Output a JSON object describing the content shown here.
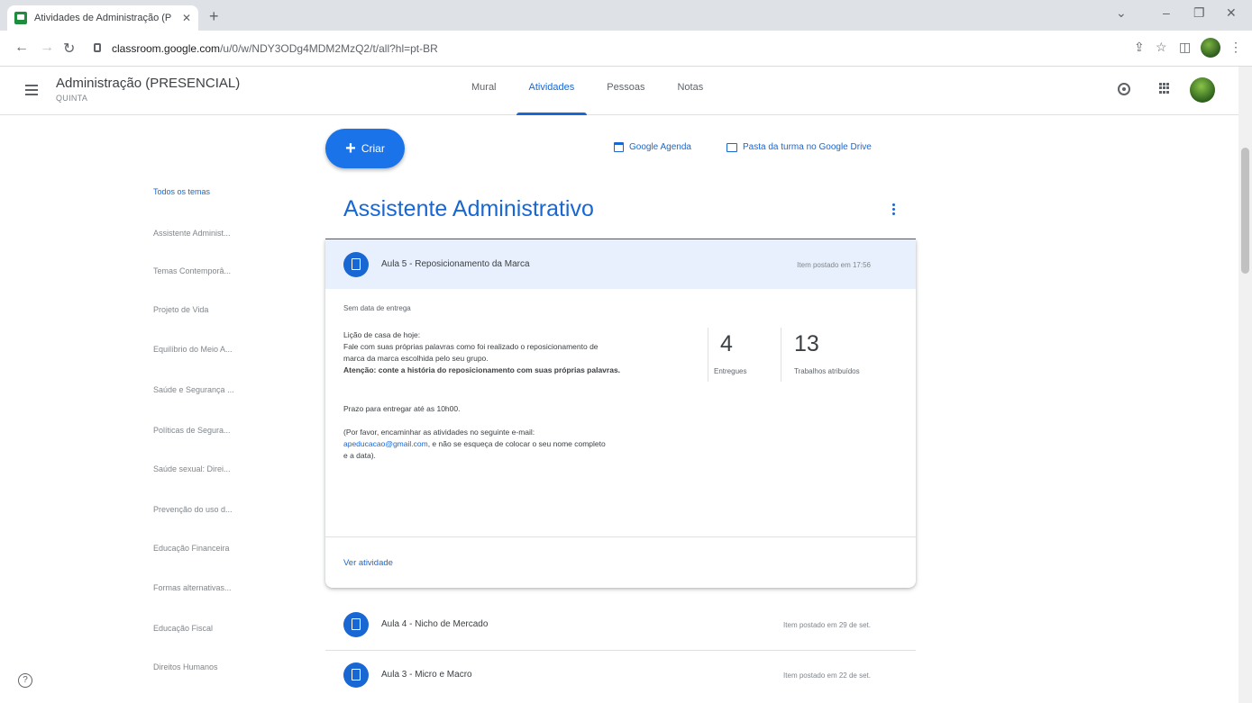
{
  "browser": {
    "tab_title": "Atividades de Administração (P",
    "tab_close": "✕",
    "new_tab": "+",
    "url_domain": "classroom.google.com",
    "url_path": "/u/0/w/NDY3ODg4MDM2MzQ2/t/all?hl=pt-BR",
    "minimize": "–",
    "maximize": "❐",
    "close": "✕",
    "dropdown": "⌄"
  },
  "header": {
    "class_name": "Administração (PRESENCIAL)",
    "class_subtitle": "QUINTA",
    "tabs": [
      {
        "label": "Mural"
      },
      {
        "label": "Atividades"
      },
      {
        "label": "Pessoas"
      },
      {
        "label": "Notas"
      }
    ]
  },
  "topics": [
    {
      "label": "Todos os temas"
    },
    {
      "label": "Assistente Administ..."
    },
    {
      "label": "Temas Contemporâ..."
    },
    {
      "label": "Projeto de Vida"
    },
    {
      "label": "Equilíbrio do Meio A..."
    },
    {
      "label": "Saúde e Segurança ..."
    },
    {
      "label": "Políticas de Segura..."
    },
    {
      "label": "Saúde sexual: Direi..."
    },
    {
      "label": "Prevenção do uso d..."
    },
    {
      "label": "Educação Financeira"
    },
    {
      "label": "Formas alternativas..."
    },
    {
      "label": "Educação Fiscal"
    },
    {
      "label": "Direitos Humanos"
    }
  ],
  "actions": {
    "create_label": "Criar",
    "create_plus": "+",
    "calendar_label": "Google Agenda",
    "drive_label": "Pasta da turma no Google Drive"
  },
  "main": {
    "topic_title": "Assistente Administrativo",
    "expanded": {
      "title": "Aula 5 - Reposicionamento da Marca",
      "posted": "Item postado em 17:56",
      "due": "Sem data de entrega",
      "line1": "Lição de casa de hoje:",
      "line2": "Fale com suas próprias palavras como foi realizado o reposicionamento de",
      "line3": "marca da marca escolhida pelo seu grupo.",
      "line4_bold": "Atenção: conte a história do reposicionamento com suas próprias palavras.",
      "line5": "Prazo para entregar até as 10h00.",
      "line6": "(Por favor, encaminhar as atividades no seguinte e-mail:",
      "email": "apeducacao@gmail.com",
      "line7": ", e não se esqueça de colocar o seu nome completo",
      "line8": "e a data).",
      "turned_in_count": "4",
      "turned_in_label": "Entregues",
      "assigned_count": "13",
      "assigned_label": "Trabalhos atribuídos",
      "view_link": "Ver atividade"
    },
    "items": [
      {
        "title": "Aula 4 - Nicho de Mercado",
        "posted": "Item postado em 29 de set."
      },
      {
        "title": "Aula 3 - Micro e Macro",
        "posted": "Item postado em 22 de set."
      }
    ]
  }
}
